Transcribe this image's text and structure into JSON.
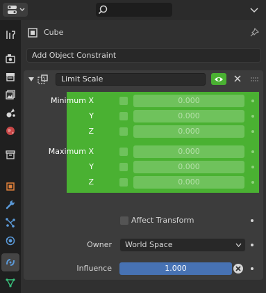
{
  "header": {
    "editor_type_icon": "properties-editor-icon",
    "search_icon": "search-icon",
    "options_icon": "options-icon"
  },
  "tabs": [
    {
      "name": "tool",
      "icon": "tool-icon",
      "active": false
    },
    {
      "name": "render",
      "icon": "render-icon",
      "active": false
    },
    {
      "name": "output",
      "icon": "output-icon",
      "active": false
    },
    {
      "name": "view-layer",
      "icon": "view-layer-icon",
      "active": false
    },
    {
      "name": "scene",
      "icon": "scene-icon",
      "active": false
    },
    {
      "name": "world",
      "icon": "world-icon",
      "active": false
    },
    {
      "name": "collection",
      "icon": "collection-icon",
      "active": false
    },
    {
      "name": "object",
      "icon": "object-icon",
      "active": false
    },
    {
      "name": "modifiers",
      "icon": "wrench-icon",
      "active": false
    },
    {
      "name": "particles",
      "icon": "particles-icon",
      "active": false
    },
    {
      "name": "physics",
      "icon": "physics-icon",
      "active": false
    },
    {
      "name": "object-constraints",
      "icon": "constraint-icon",
      "active": true
    },
    {
      "name": "object-data",
      "icon": "mesh-data-icon",
      "active": false
    }
  ],
  "object": {
    "name": "Cube"
  },
  "add_constraint_label": "Add Object Constraint",
  "constraint": {
    "name": "Limit Scale",
    "enabled": true,
    "minimum": [
      {
        "label": "Minimum X",
        "value": "0.000",
        "enabled": false
      },
      {
        "label": "Y",
        "value": "0.000",
        "enabled": false
      },
      {
        "label": "Z",
        "value": "0.000",
        "enabled": false
      }
    ],
    "maximum": [
      {
        "label": "Maximum X",
        "value": "0.000",
        "enabled": false
      },
      {
        "label": "Y",
        "value": "0.000",
        "enabled": false
      },
      {
        "label": "Z",
        "value": "0.000",
        "enabled": false
      }
    ],
    "affect_transform": {
      "label": "Affect Transform",
      "checked": false
    },
    "owner": {
      "label": "Owner",
      "value": "World Space"
    },
    "influence": {
      "label": "Influence",
      "value": "1.000",
      "fraction": 1.0
    }
  },
  "colors": {
    "accent_green": "#4ab132",
    "slider_blue": "#4772b3",
    "panel_bg": "#303030"
  }
}
